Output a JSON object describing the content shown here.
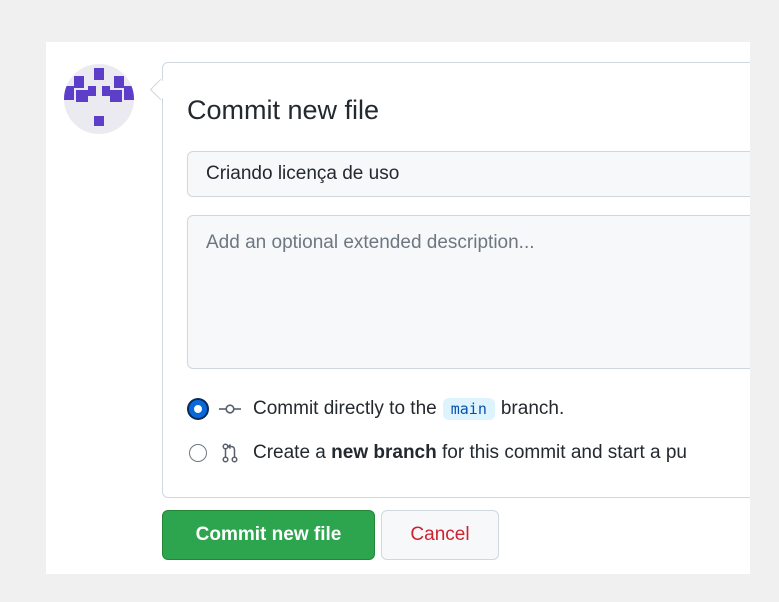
{
  "avatar": {
    "icon": "identicon",
    "color": "#5c3ec8"
  },
  "commit_form": {
    "title": "Commit new file",
    "summary_value": "Criando licença de uso",
    "description_placeholder": "Add an optional extended description...",
    "option_direct": {
      "icon": "git-commit-icon",
      "prefix": "Commit directly to the",
      "branch": "main",
      "suffix": "branch.",
      "selected": true
    },
    "option_new_branch": {
      "icon": "git-pull-request-icon",
      "prefix": "Create a",
      "bold": "new branch",
      "suffix": "for this commit and start a pu",
      "selected": false
    }
  },
  "buttons": {
    "commit_label": "Commit new file",
    "cancel_label": "Cancel"
  },
  "colors": {
    "primary_green": "#2da44e",
    "cancel_red": "#cf222e",
    "radio_blue": "#0969da"
  }
}
